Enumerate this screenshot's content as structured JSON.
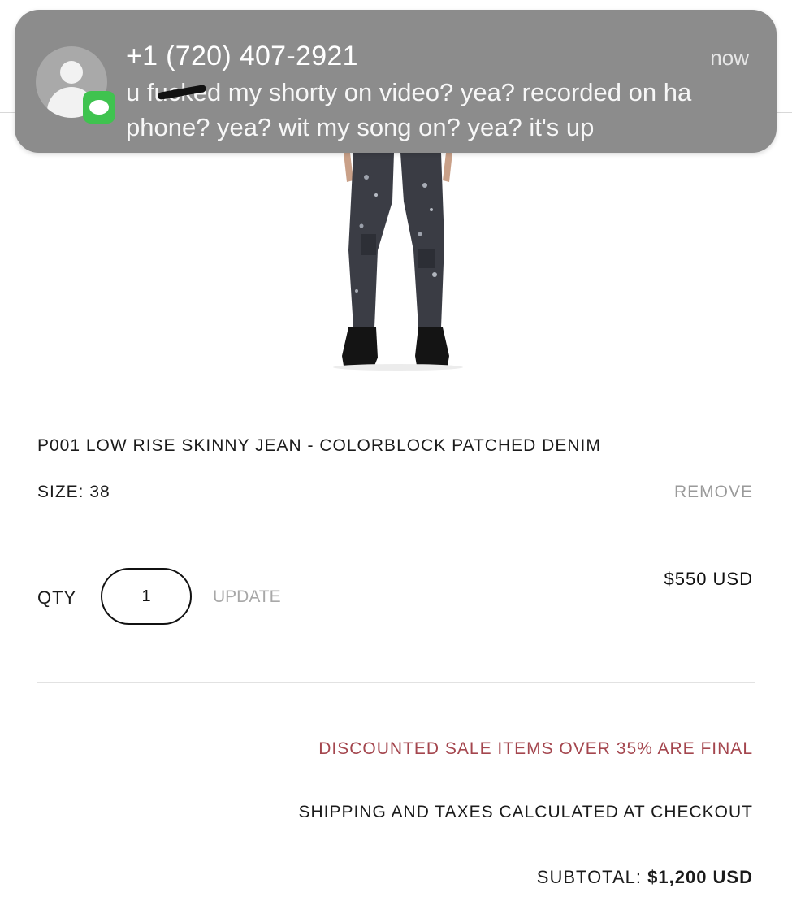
{
  "notification": {
    "sender": "+1 (720) 407-2921",
    "time": "now",
    "message": "u fucked my shorty on video? yea? recorded on ha phone? yea? wit my song on? yea? it's up",
    "avatar_icon": "contact-placeholder-icon",
    "app_icon": "messages-icon",
    "app_color": "#3fc34f"
  },
  "cart": {
    "item": {
      "title": "P001 LOW RISE SKINNY JEAN - COLORBLOCK PATCHED DENIM",
      "size": "SIZE: 38",
      "remove_label": "REMOVE",
      "qty_label": "QTY",
      "qty_value": "1",
      "update_label": "UPDATE",
      "price": "$550 USD"
    },
    "sale_note": "DISCOUNTED SALE ITEMS OVER 35% ARE FINAL",
    "sale_note_color": "#a4464e",
    "shipping_note": "SHIPPING AND TAXES CALCULATED AT CHECKOUT",
    "subtotal_label": "SUBTOTAL:",
    "subtotal_value": "$1,200 USD"
  }
}
